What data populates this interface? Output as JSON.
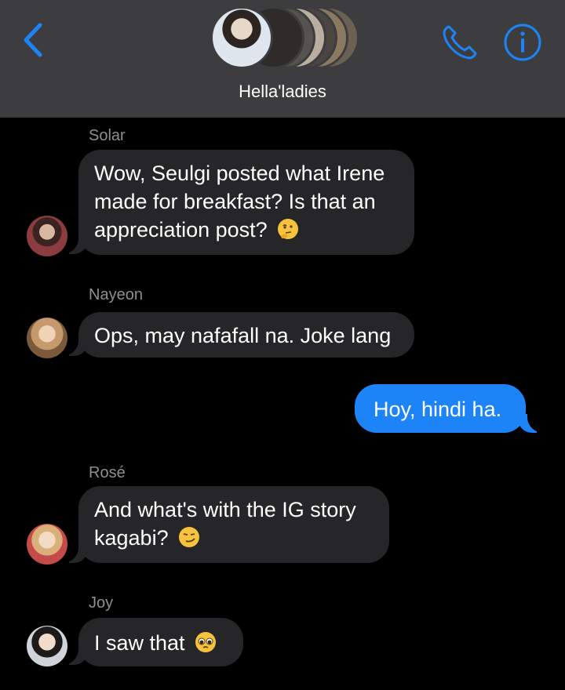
{
  "header": {
    "title": "Hella'ladies",
    "back_icon": "chevron-left-icon",
    "call_icon": "phone-icon",
    "info_icon": "info-icon",
    "accent_color": "#1c84f6"
  },
  "messages": [
    {
      "sender": "Solar",
      "text": "Wow, Seulgi posted what Irene made for breakfast? Is that an appreciation post?",
      "emoji": "thinking-face-emoji",
      "direction": "incoming"
    },
    {
      "sender": "Nayeon",
      "text": "Ops, may nafafall na. Joke lang",
      "direction": "incoming"
    },
    {
      "text": "Hoy, hindi ha.",
      "direction": "outgoing"
    },
    {
      "sender": "Rosé",
      "text": "And what's with the IG story kagabi?",
      "emoji": "smirking-face-emoji",
      "direction": "incoming"
    },
    {
      "sender": "Joy",
      "text": "I saw that",
      "emoji": "pleading-face-emoji",
      "direction": "incoming"
    }
  ]
}
